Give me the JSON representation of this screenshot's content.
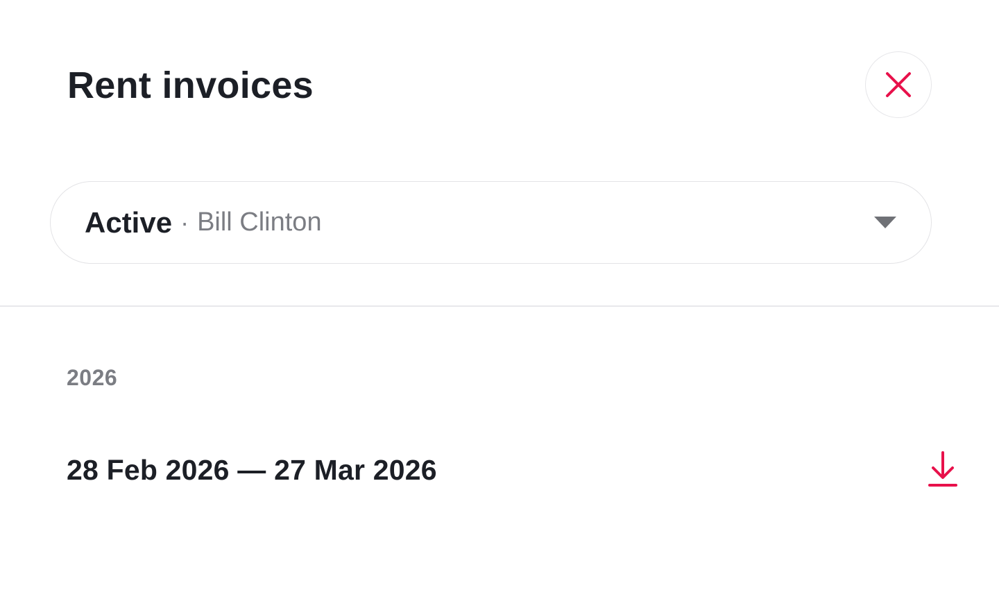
{
  "header": {
    "title": "Rent invoices",
    "close_icon": "close-icon"
  },
  "selector": {
    "status": "Active",
    "separator": "·",
    "tenant": "Bill Clinton",
    "caret_icon": "caret-down-icon"
  },
  "invoices": {
    "groups": [
      {
        "year": "2026",
        "items": [
          {
            "period": "28 Feb 2026 — 27 Mar 2026",
            "action_icon": "download-icon"
          }
        ]
      }
    ]
  },
  "colors": {
    "accent": "#e8114b",
    "text_primary": "#1c1f26",
    "text_secondary": "#7b7d83",
    "border": "#e3e3e6"
  }
}
